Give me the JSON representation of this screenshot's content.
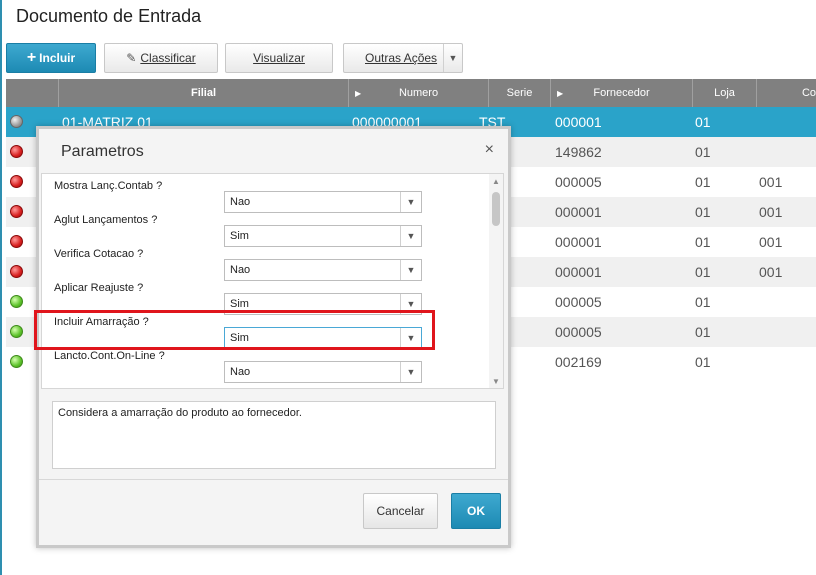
{
  "page": {
    "title": "Documento de Entrada"
  },
  "toolbar": {
    "incluir": {
      "plus": "+",
      "label": "Incluir"
    },
    "classificar": {
      "icon": "pencil-icon",
      "label": "Classificar"
    },
    "visualizar": {
      "label": "Visualizar"
    },
    "outras_acoes": {
      "label": "Outras Ações",
      "arrow": "▼"
    }
  },
  "grid": {
    "columns": [
      "Filial",
      "Numero",
      "Serie",
      "Fornecedor",
      "Loja",
      "Co"
    ],
    "rows": [
      {
        "status": "gray",
        "filial": "01-MATRIZ 01",
        "numero": "000000001",
        "serie": "TST",
        "fornecedor": "000001",
        "loja": "01",
        "co": ""
      },
      {
        "status": "red",
        "filial": "",
        "numero": "",
        "serie": "",
        "fornecedor": "149862",
        "loja": "01",
        "co": ""
      },
      {
        "status": "red",
        "filial": "",
        "numero": "",
        "serie": "",
        "fornecedor": "000005",
        "loja": "01",
        "co": "001"
      },
      {
        "status": "red",
        "filial": "",
        "numero": "",
        "serie": "",
        "fornecedor": "000001",
        "loja": "01",
        "co": "001"
      },
      {
        "status": "red",
        "filial": "",
        "numero": "",
        "serie": "",
        "fornecedor": "000001",
        "loja": "01",
        "co": "001"
      },
      {
        "status": "red",
        "filial": "",
        "numero": "",
        "serie": "",
        "fornecedor": "000001",
        "loja": "01",
        "co": "001"
      },
      {
        "status": "green",
        "filial": "",
        "numero": "",
        "serie": "",
        "fornecedor": "000005",
        "loja": "01",
        "co": ""
      },
      {
        "status": "green",
        "filial": "",
        "numero": "",
        "serie": "",
        "fornecedor": "000005",
        "loja": "01",
        "co": ""
      },
      {
        "status": "green",
        "filial": "",
        "numero": "",
        "serie": "",
        "fornecedor": "002169",
        "loja": "01",
        "co": ""
      }
    ]
  },
  "dialog": {
    "title": "Parametros",
    "close": "×",
    "params": [
      {
        "label": "Mostra Lanç.Contab ?",
        "value": "Nao"
      },
      {
        "label": "Aglut Lançamentos ?",
        "value": "Sim"
      },
      {
        "label": "Verifica Cotacao ?",
        "value": "Nao"
      },
      {
        "label": "Aplicar Reajuste ?",
        "value": "Sim"
      },
      {
        "label": "Incluir Amarração ?",
        "value": "Sim"
      },
      {
        "label": "Lancto.Cont.On-Line ?",
        "value": "Nao"
      }
    ],
    "help_text": "Considera a amarração do produto ao fornecedor.",
    "cancel_label": "Cancelar",
    "ok_label": "OK"
  },
  "colors": {
    "accent": "#2aa3c9",
    "highlight": "#e0151c",
    "header": "#808080"
  }
}
